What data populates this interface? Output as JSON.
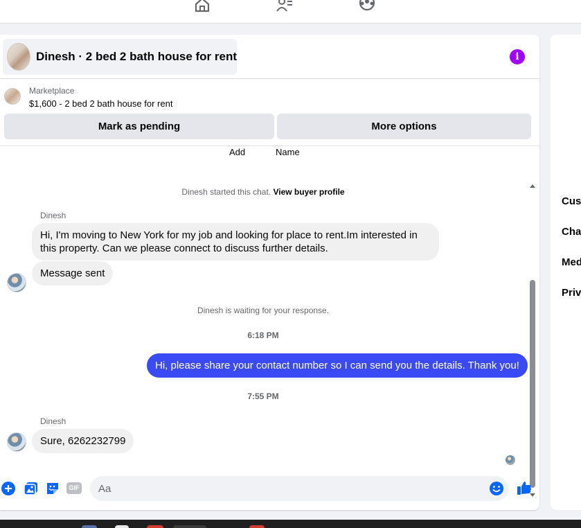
{
  "nav": {
    "icons": [
      "home-icon",
      "friends-icon",
      "groups-icon"
    ]
  },
  "header": {
    "title": "Dinesh · 2 bed 2 bath house for rent",
    "info_icon": "i"
  },
  "marketplace": {
    "label": "Marketplace",
    "listing": "$1,600 - 2 bed 2 bath house for rent",
    "buttons": {
      "pending": "Mark as pending",
      "more": "More options"
    }
  },
  "columns": [
    "Add",
    "Name"
  ],
  "messages": {
    "started": "Dinesh started this chat.",
    "view_profile": "View buyer profile",
    "sender1": "Dinesh",
    "msg1": "Hi, I'm moving to New York for my job and looking for place to rent.Im interested in this property. Can we please connect to discuss further details.",
    "msg2": "Message sent",
    "waiting": "Dinesh is waiting for your response.",
    "time1": "6:18 PM",
    "out1": "Hi, please share your contact number so I can send you the details. Thank you!",
    "time2": "7:55 PM",
    "sender2": "Dinesh",
    "msg3": "Sure, 6262232799"
  },
  "composer": {
    "placeholder": "Aa",
    "gif_label": "GIF"
  },
  "right_panel": {
    "items": [
      "Cust",
      "Chat",
      "Med",
      "Priva"
    ]
  },
  "colors": {
    "accent_blue": "#0866ff",
    "outgoing_bubble": "#3a4af5",
    "info_purple": "#a100ff"
  }
}
